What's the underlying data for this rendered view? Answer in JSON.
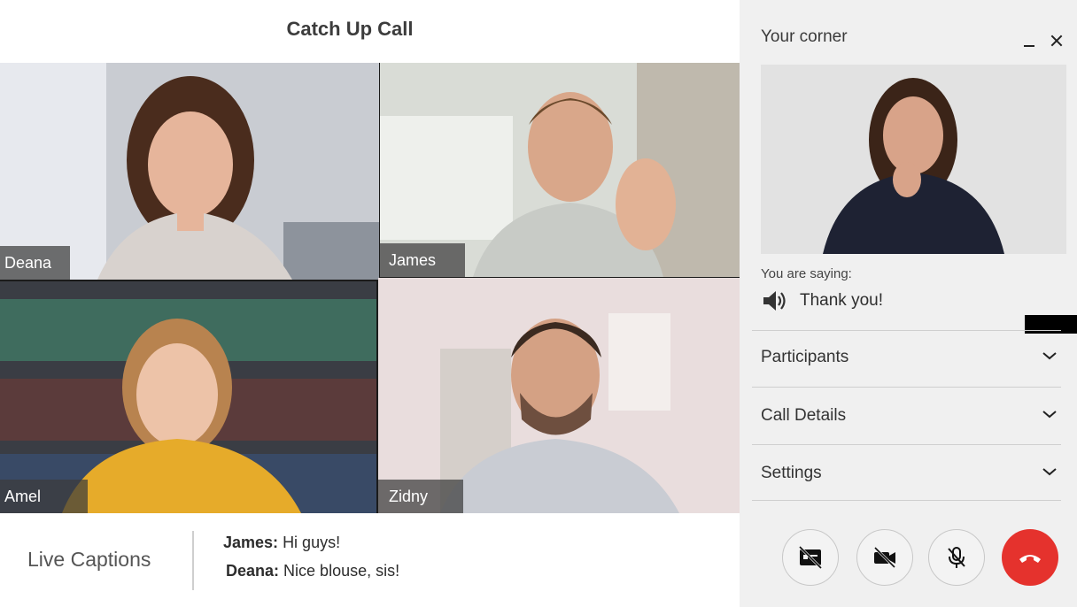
{
  "call": {
    "title": "Catch Up Call"
  },
  "participants": [
    {
      "name": "Deana"
    },
    {
      "name": "James"
    },
    {
      "name": "Amel"
    },
    {
      "name": "Zidny"
    }
  ],
  "captions": {
    "label": "Live Captions",
    "lines": [
      {
        "speaker": "James:",
        "text": "Hi guys!"
      },
      {
        "speaker": "Deana:",
        "text": "Nice blouse, sis!"
      }
    ]
  },
  "panel": {
    "title": "Your corner",
    "saying_label": "You are saying:",
    "saying_text": "Thank you!",
    "sections": [
      {
        "label": "Participants",
        "icon": "chevron-down-icon"
      },
      {
        "label": "Call Details",
        "icon": "chevron-down-icon"
      },
      {
        "label": "Settings",
        "icon": "chevron-down-icon"
      }
    ],
    "controls": [
      {
        "name": "captions-off-button",
        "icon": "captions-off-icon"
      },
      {
        "name": "video-off-button",
        "icon": "video-off-icon"
      },
      {
        "name": "mic-off-button",
        "icon": "mic-off-icon"
      },
      {
        "name": "end-call-button",
        "icon": "phone-hangup-icon"
      }
    ]
  },
  "colors": {
    "end_call": "#e5322d",
    "panel_bg": "#f0f0f0",
    "name_tag_bg": "#3c3c3c"
  }
}
